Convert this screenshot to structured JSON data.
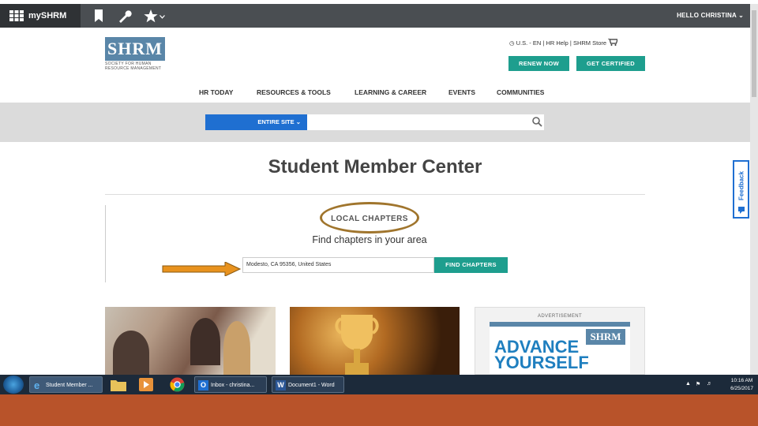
{
  "topbar": {
    "brand": "mySHRM",
    "greeting": "HELLO CHRISTINA",
    "icons": [
      "grid-icon",
      "bookmark-icon",
      "wrench-icon",
      "star-icon",
      "chevron-down-icon"
    ]
  },
  "header": {
    "logo_text": "SHRM",
    "logo_subtext": "SOCIETY FOR HUMAN RESOURCE MANAGEMENT",
    "utility_links": {
      "region": "U.S. - EN",
      "sep1": "|",
      "help": "HR Help",
      "sep2": "|",
      "store": "SHRM Store"
    },
    "renew_label": "RENEW NOW",
    "certified_label": "GET CERTIFIED"
  },
  "nav": {
    "items": [
      "HR TODAY",
      "RESOURCES & TOOLS",
      "LEARNING & CAREER",
      "EVENTS",
      "COMMUNITIES"
    ]
  },
  "search": {
    "scope_label": "ENTIRE SITE",
    "placeholder": ""
  },
  "main": {
    "title": "Student Member Center",
    "section_label": "LOCAL CHAPTERS",
    "subtitle": "Find chapters in your area",
    "location_value": "Modesto, CA 95356, United States",
    "find_label": "FIND CHAPTERS"
  },
  "feedback": {
    "label": "Feedback"
  },
  "advertisement": {
    "label": "ADVERTISEMENT",
    "headline": "ADVANCE YOURSELF",
    "logo_text": "SHRM"
  },
  "taskbar": {
    "tasks": [
      "Student Member ...",
      "Inbox - christina...",
      "Document1 - Word"
    ],
    "time": "10:16 AM",
    "date": "6/25/2017"
  },
  "colors": {
    "topbar": "#4a4e52",
    "accent_green": "#1e9e8e",
    "scope_blue": "#1f6fd1",
    "annotation_brown": "#a0752d",
    "arrow_orange": "#e8921e",
    "footer_orange": "#b8532a"
  }
}
